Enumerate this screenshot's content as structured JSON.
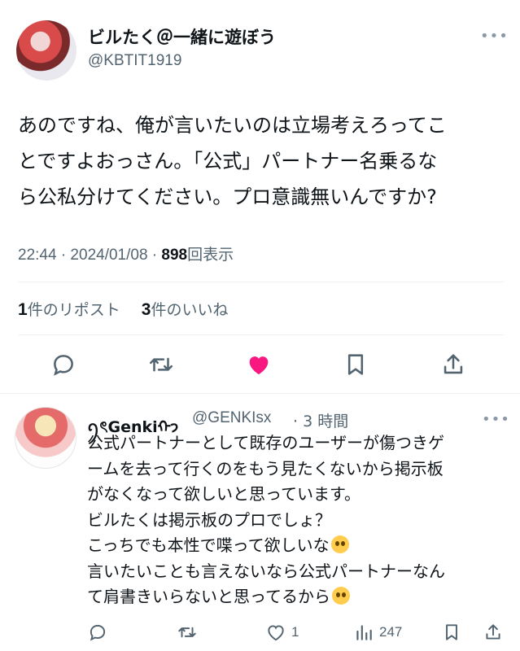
{
  "tweet": {
    "author_name": "ビルたく＠一緒に遊ぼう",
    "author_handle": "@KBTIT1919",
    "more": "•••",
    "text_lines": [
      "あのですね、俺が言いたいのは立場考えろってこ",
      "とですよおっさん。「公式」パートナー名乗るな",
      "ら公私分けてください。プロ意識無いんですか?"
    ],
    "time": "22:44 · 2024/01/08 · ",
    "views_count": "898",
    "views_label": "回表示",
    "reposts_count": "1",
    "reposts_label": "件のリポスト",
    "likes_count": "3",
    "likes_label": "件のいいね"
  },
  "actions": {
    "reply_icon": "reply-icon",
    "repost_icon": "repost-icon",
    "like_icon": "heart-filled-icon",
    "bookmark_icon": "bookmark-icon",
    "share_icon": "share-icon"
  },
  "reply": {
    "author_name": "ꪆৎGenkiᡣ𐭩",
    "author_handle": "@GENKIsx",
    "time": "· 3 時間",
    "more": "•••",
    "text_lines": [
      "公式パートナーとして既存のユーザーが傷つきゲ",
      "ームを去って行くのをもう見たくないから掲示板",
      "がなくなって欲しいと思っています。",
      "ビルたくは掲示板のプロでしょ？",
      "こっちでも本性で喋って欲しいな",
      "言いたいことも言えないなら公式パートナーなん",
      "て肩書きいらないと思ってるから"
    ],
    "like_count": "1",
    "views_count": "247"
  },
  "colors": {
    "like": "#f91880",
    "icon": "#536471",
    "text": "#0f1419",
    "secondary": "#536471",
    "divider": "#eff3f4"
  }
}
